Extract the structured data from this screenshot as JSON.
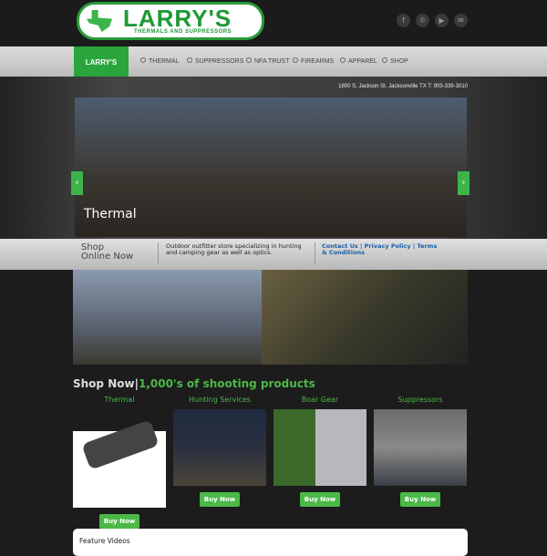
{
  "logo": {
    "name": "LARRY'S",
    "tagline": "THERMALS AND SUPPRESSORS"
  },
  "social": [
    {
      "icon": "facebook-icon",
      "glyph": "f"
    },
    {
      "icon": "pinterest-icon",
      "glyph": "℗"
    },
    {
      "icon": "youtube-icon",
      "glyph": "▶"
    },
    {
      "icon": "email-icon",
      "glyph": "✉"
    }
  ],
  "nav": {
    "badge": "LARRY'S",
    "items": [
      "THERMAL",
      "SUPPRESSORS",
      "NFA TRUST",
      "FIREARMS",
      "APPAREL",
      "SHOP"
    ]
  },
  "address": "1800 S. Jackson St. Jacksonville TX T: 903-339-3010",
  "slider": {
    "caption": "Thermal",
    "prev": "‹",
    "next": "›"
  },
  "infobar": {
    "shop": "Shop Online Now",
    "description": "Outdoor outfitter store specializing in hunting and camping gear as well as optics.",
    "links": [
      "Contact Us",
      "Privacy Policy",
      "Terms & Conditions"
    ],
    "separator": " | "
  },
  "shop": {
    "title": "Shop Now",
    "subtitle": "1,000's of shooting products",
    "products": [
      {
        "title": "Thermal",
        "button": "Buy Now"
      },
      {
        "title": "Hunting Services",
        "button": "Buy Now"
      },
      {
        "title": "Boar Gear",
        "button": "Buy Now"
      },
      {
        "title": "Suppressors",
        "button": "Buy Now"
      }
    ]
  },
  "feature": {
    "title": "Feature Videos"
  },
  "colors": {
    "accent": "#4cb848",
    "link": "#1a5fa8"
  }
}
